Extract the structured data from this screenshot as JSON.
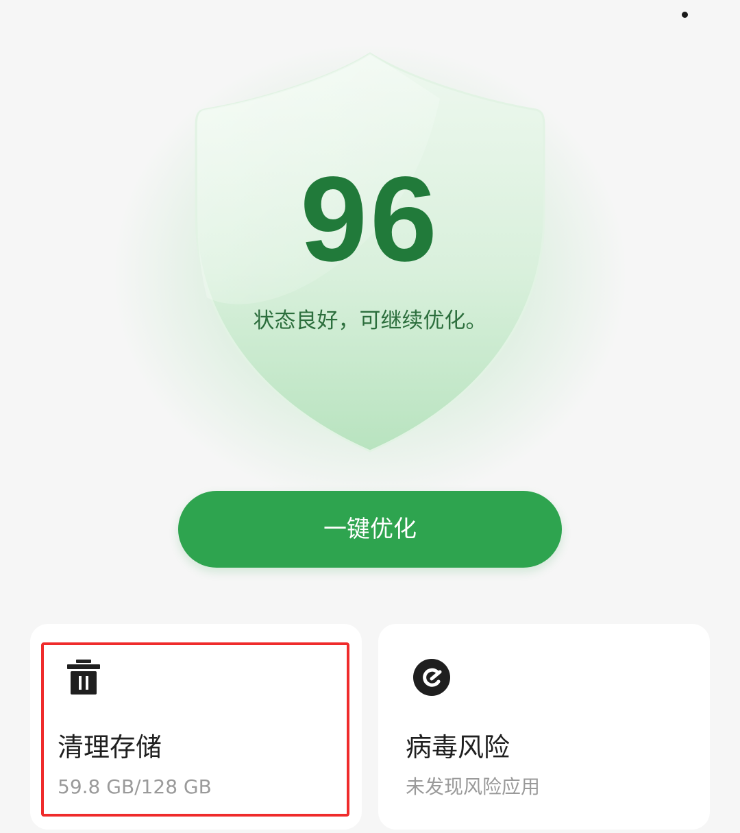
{
  "header": {
    "more_icon": "more-vertical-icon"
  },
  "status": {
    "score": "96",
    "message": "状态良好，可继续优化。",
    "shield_icon": "shield-icon",
    "accent_color": "#2ea44f"
  },
  "actions": {
    "optimize_label": "一键优化"
  },
  "cards": [
    {
      "icon": "trash-icon",
      "title": "清理存储",
      "subtitle": "59.8 GB/128 GB"
    },
    {
      "icon": "virus-scan-icon",
      "title": "病毒风险",
      "subtitle": "未发现风险应用"
    }
  ],
  "highlight_color": "#ef2b2b"
}
